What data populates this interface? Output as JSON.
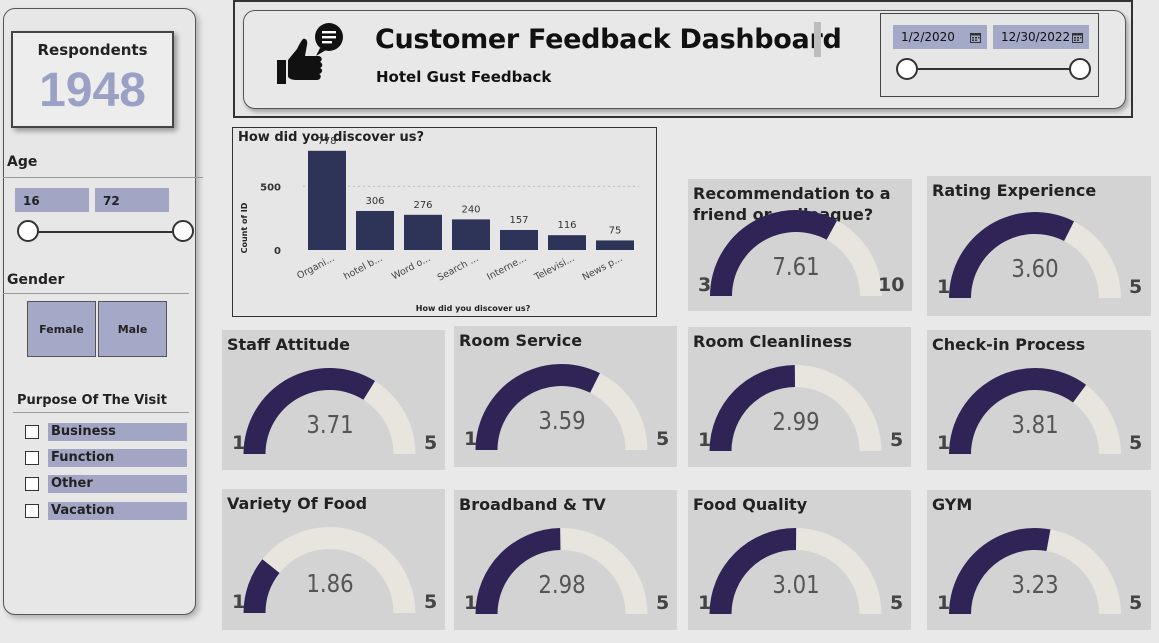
{
  "sidebar": {
    "respondents_label": "Respondents",
    "respondents_value": "1948",
    "age_label": "Age",
    "age_min": "16",
    "age_max": "72",
    "gender_label": "Gender",
    "gender_options": [
      "Female",
      "Male"
    ],
    "purpose_label": "Purpose Of The Visit",
    "purpose_options": [
      "Business",
      "Function",
      "Other",
      "Vacation"
    ]
  },
  "header": {
    "title": "Customer Feedback Dashboard",
    "subtitle": "Hotel Gust Feedback",
    "date_start": "1/2/2020",
    "date_end": "12/30/2022",
    "icon": "thumbs-up-chat-icon"
  },
  "chart_data": {
    "type": "bar",
    "title": "How did you discover us?",
    "xlabel": "How did you discover us?",
    "ylabel": "Count of ID",
    "categories": [
      "Organi...",
      "hotel b...",
      "Word o...",
      "Search ...",
      "Interne...",
      "Televisi...",
      "News p..."
    ],
    "values": [
      778,
      306,
      276,
      240,
      157,
      116,
      75
    ],
    "y_ticks": [
      0,
      500
    ],
    "ylim": [
      0,
      800
    ],
    "bar_color": "#2e3358"
  },
  "gauges": [
    {
      "id": "recommendation",
      "title": "Recommendation to a friend or colleague?",
      "title_lines": [
        "Recommendation to a",
        "friend or colleague?"
      ],
      "value": 7.61,
      "display": "7.61",
      "min": 3,
      "max": 10,
      "min_label": "3",
      "max_label": "10"
    },
    {
      "id": "rating-experience",
      "title": "Rating Experience",
      "title_lines": [
        "Rating Experience"
      ],
      "value": 3.6,
      "display": "3.60",
      "min": 1,
      "max": 5,
      "min_label": "1",
      "max_label": "5"
    },
    {
      "id": "staff-attitude",
      "title": "Staff Attitude",
      "title_lines": [
        "Staff Attitude"
      ],
      "value": 3.71,
      "display": "3.71",
      "min": 1,
      "max": 5,
      "min_label": "1",
      "max_label": "5"
    },
    {
      "id": "room-service",
      "title": "Room Service",
      "title_lines": [
        "Room Service"
      ],
      "value": 3.59,
      "display": "3.59",
      "min": 1,
      "max": 5,
      "min_label": "1",
      "max_label": "5"
    },
    {
      "id": "room-cleanliness",
      "title": "Room Cleanliness",
      "title_lines": [
        "Room Cleanliness"
      ],
      "value": 2.99,
      "display": "2.99",
      "min": 1,
      "max": 5,
      "min_label": "1",
      "max_label": "5"
    },
    {
      "id": "check-in-process",
      "title": "Check-in Process",
      "title_lines": [
        "Check-in Process"
      ],
      "value": 3.81,
      "display": "3.81",
      "min": 1,
      "max": 5,
      "min_label": "1",
      "max_label": "5"
    },
    {
      "id": "variety-of-food",
      "title": "Variety Of Food",
      "title_lines": [
        "Variety Of Food"
      ],
      "value": 1.86,
      "display": "1.86",
      "min": 1,
      "max": 5,
      "min_label": "1",
      "max_label": "5"
    },
    {
      "id": "broadband-tv",
      "title": "Broadband & TV",
      "title_lines": [
        "Broadband & TV"
      ],
      "value": 2.98,
      "display": "2.98",
      "min": 1,
      "max": 5,
      "min_label": "1",
      "max_label": "5"
    },
    {
      "id": "food-quality",
      "title": "Food Quality",
      "title_lines": [
        "Food Quality"
      ],
      "value": 3.01,
      "display": "3.01",
      "min": 1,
      "max": 5,
      "min_label": "1",
      "max_label": "5"
    },
    {
      "id": "gym",
      "title": "GYM",
      "title_lines": [
        "GYM"
      ],
      "value": 3.23,
      "display": "3.23",
      "min": 1,
      "max": 5,
      "min_label": "1",
      "max_label": "5"
    }
  ],
  "colors": {
    "gauge_fill": "#302356",
    "gauge_track": "#e8e4de",
    "card_bg": "#d3d3d3",
    "slicer_fill": "#a2a6c4",
    "respondents_value": "#9aa1c5"
  }
}
